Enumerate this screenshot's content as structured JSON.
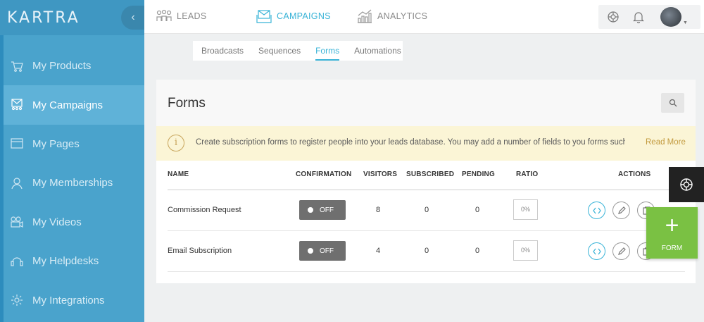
{
  "app": {
    "logo": "KARTRA",
    "collapse_icon": "chevron-left-icon"
  },
  "sidebar": {
    "items": [
      {
        "label": "My Products",
        "icon": "products-icon",
        "active": false
      },
      {
        "label": "My Campaigns",
        "icon": "campaigns-icon",
        "active": true
      },
      {
        "label": "My Pages",
        "icon": "pages-icon",
        "active": false
      },
      {
        "label": "My Memberships",
        "icon": "memberships-icon",
        "active": false
      },
      {
        "label": "My Videos",
        "icon": "videos-icon",
        "active": false
      },
      {
        "label": "My Helpdesks",
        "icon": "helpdesks-icon",
        "active": false
      },
      {
        "label": "My Integrations",
        "icon": "integrations-icon",
        "active": false
      }
    ]
  },
  "topnav": {
    "tabs": [
      {
        "label": "LEADS",
        "icon": "leads-icon",
        "active": false
      },
      {
        "label": "CAMPAIGNS",
        "icon": "campaigns-icon",
        "active": true
      },
      {
        "label": "ANALYTICS",
        "icon": "analytics-icon",
        "active": false
      }
    ],
    "right_icons": [
      "help-icon",
      "bell-icon",
      "avatar"
    ]
  },
  "subnav": {
    "tabs": [
      {
        "label": "Broadcasts",
        "active": false
      },
      {
        "label": "Sequences",
        "active": false
      },
      {
        "label": "Forms",
        "active": true
      },
      {
        "label": "Automations",
        "active": false
      }
    ]
  },
  "page": {
    "title": "Forms",
    "notice": "Create subscription forms to register people into your leads database. You may add a number of fields to you forms such as Fir...",
    "read_more": "Read More"
  },
  "table": {
    "headers": [
      "NAME",
      "CONFIRMATION",
      "VISITORS",
      "SUBSCRIBED",
      "PENDING",
      "RATIO",
      "ACTIONS"
    ],
    "rows": [
      {
        "name": "Commission Request",
        "confirmation": "OFF",
        "visitors": "8",
        "subscribed": "0",
        "pending": "0",
        "ratio": "0%"
      },
      {
        "name": "Email Subscription",
        "confirmation": "OFF",
        "visitors": "4",
        "subscribed": "0",
        "pending": "0",
        "ratio": "0%"
      }
    ],
    "actions": [
      "embed-code-icon",
      "edit-icon",
      "copy-icon",
      "delete-icon"
    ]
  },
  "floating": {
    "add_label": "FORM",
    "add_icon": "plus-icon",
    "help_icon": "help-icon"
  },
  "colors": {
    "sidebar": "#4aa3cc",
    "accent": "#39b3d7",
    "notice_bg": "#fbf5d6",
    "add_button": "#7ac143"
  }
}
